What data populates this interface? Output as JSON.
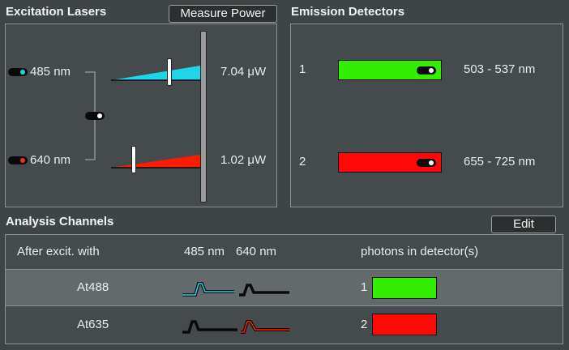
{
  "excitation": {
    "title": "Excitation Lasers",
    "measure_button": "Measure Power",
    "lasers": [
      {
        "label": "485 nm",
        "power": "7.04 μW",
        "color": "#1fd6e8",
        "enabled": true,
        "level": 0.55
      },
      {
        "label": "640 nm",
        "power": "1.02 μW",
        "color": "#ff1a00",
        "enabled": true,
        "level": 0.25
      }
    ]
  },
  "emission": {
    "title": "Emission Detectors",
    "detectors": [
      {
        "index": "1",
        "range": "503 - 537 nm",
        "color": "#33ee00",
        "enabled": true
      },
      {
        "index": "2",
        "range": "655 - 725 nm",
        "color": "#ff0808",
        "enabled": true
      }
    ]
  },
  "analysis": {
    "title": "Analysis Channels",
    "edit_button": "Edit",
    "header": {
      "after_excit": "After excit. with",
      "laser1": "485 nm",
      "laser2": "640 nm",
      "photons": "photons in detector(s)"
    },
    "channels": [
      {
        "name": "At488",
        "detector": "1",
        "detector_color": "#33ee00",
        "active_laser": "485"
      },
      {
        "name": "At635",
        "detector": "2",
        "detector_color": "#ff0808",
        "active_laser": "640"
      }
    ]
  }
}
